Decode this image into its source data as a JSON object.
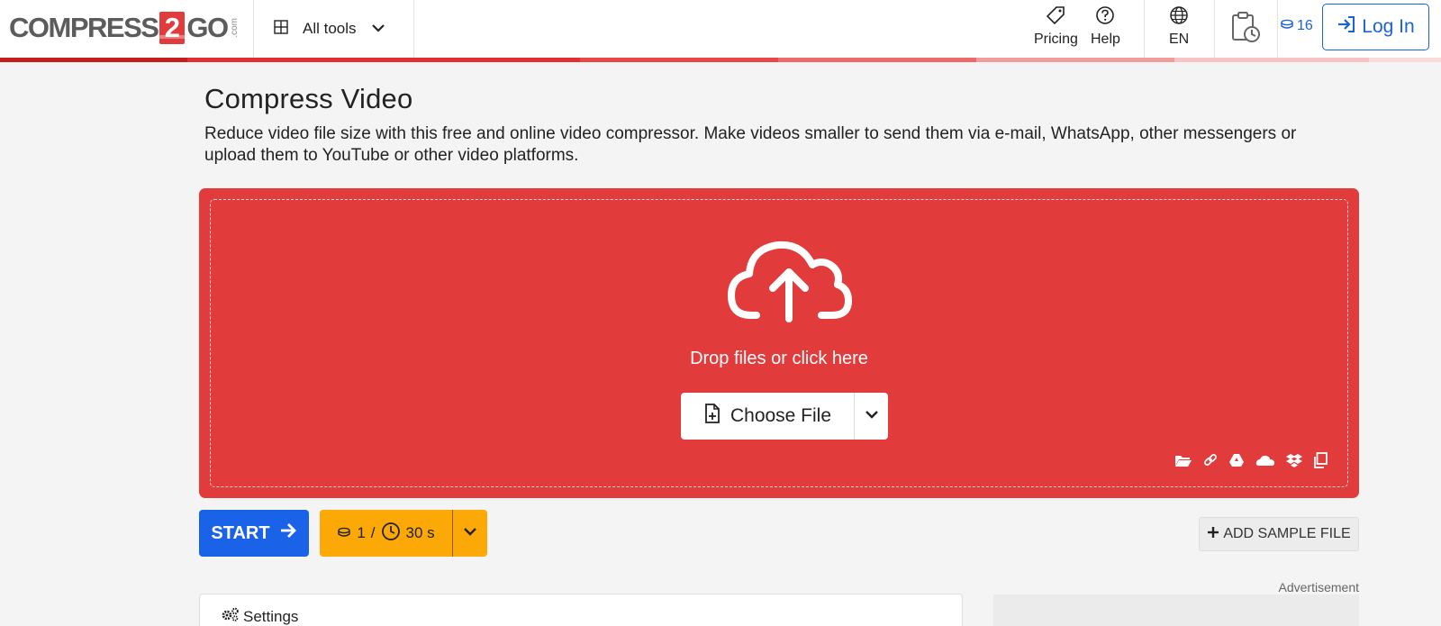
{
  "header": {
    "logo": {
      "text_left": "COMPRESS",
      "badge": "2",
      "text_right": "GO",
      "suffix": ".com"
    },
    "all_tools_label": "All tools",
    "pricing_label": "Pricing",
    "help_label": "Help",
    "language_label": "EN",
    "credits_count": "16",
    "login_label": "Log In",
    "icons": [
      "grid-icon",
      "chevron-down-icon",
      "tag-icon",
      "question-icon",
      "globe-icon",
      "clipboard-clock-icon",
      "coins-icon",
      "sign-in-icon"
    ]
  },
  "colors": {
    "brand_red": "#e23b3b",
    "primary_blue": "#1a63e8",
    "cost_orange": "#fca806",
    "page_bg": "#f4f4f4"
  },
  "main": {
    "title": "Compress Video",
    "description": "Reduce video file size with this free and online video compressor. Make videos smaller to send them via e-mail, WhatsApp, other messengers or upload them to YouTube or other video platforms.",
    "dropzone": {
      "drop_text": "Drop files or click here",
      "choose_file_label": "Choose File",
      "source_icons": [
        "folder-icon",
        "link-icon",
        "google-drive-icon",
        "onedrive-icon",
        "dropbox-icon",
        "clipboard-icon"
      ]
    },
    "start_label": "START",
    "cost": {
      "credits": "1",
      "separator": "/",
      "time": "30 s"
    },
    "add_sample_label": "ADD SAMPLE FILE",
    "advertisement_label": "Advertisement",
    "settings_label": "Settings"
  }
}
